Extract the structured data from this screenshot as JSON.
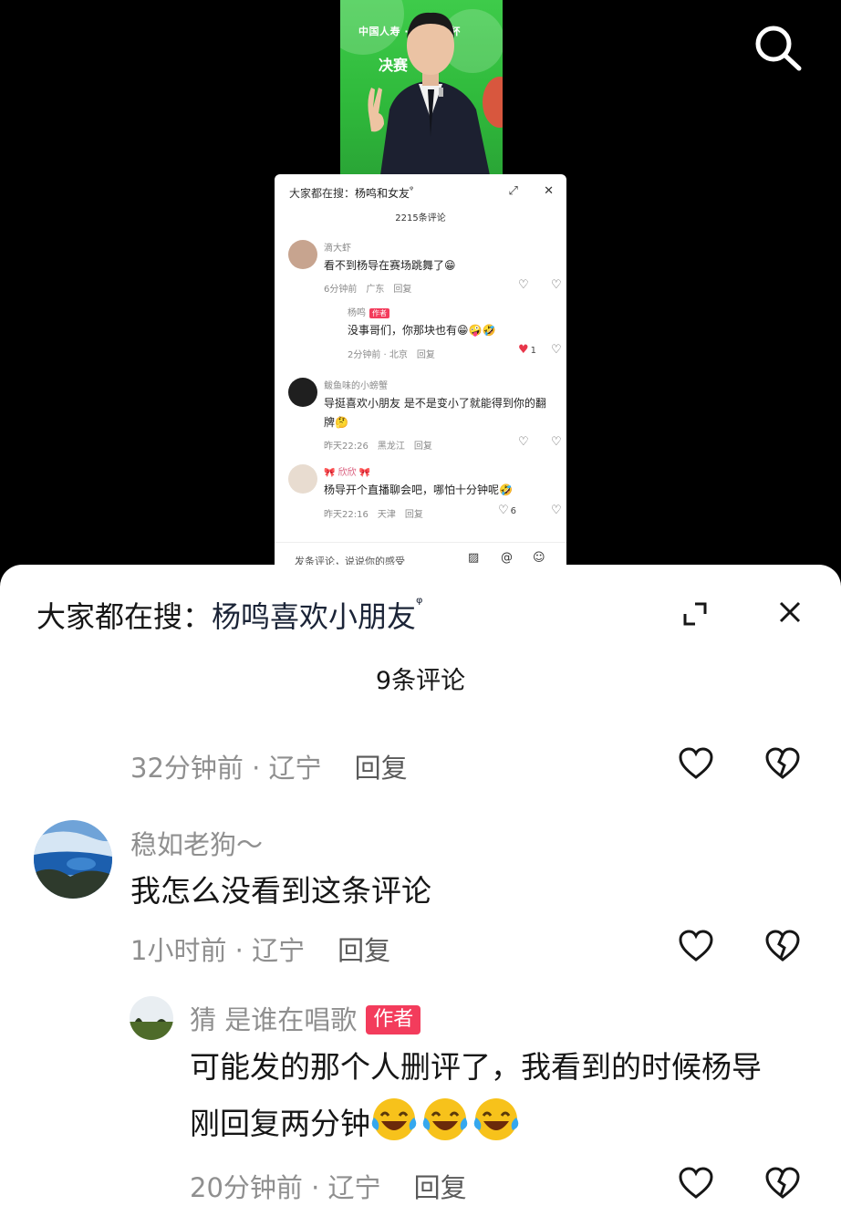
{
  "mini_panel": {
    "search_prefix": "大家都在搜：",
    "search_term": "杨鸣和女友",
    "search_icon_glyph": "ᵠ",
    "expand_glyph": "⤢",
    "close_glyph": "✕",
    "comment_count": "2215条评论",
    "comments": [
      {
        "name": "滴大虾",
        "text": "看不到杨导在赛场跳舞了😁",
        "time": "6分钟前",
        "location": "广东",
        "reply": "回复",
        "likes": ""
      },
      {
        "name": "杨鸣",
        "tag": "作者",
        "text": "没事哥们，你那块也有😁🤪🤣",
        "time": "2分钟前 · 北京",
        "reply": "回复",
        "likes": "1"
      },
      {
        "name": "鲅鱼味的小螃蟹",
        "text": "导挺喜欢小朋友 是不是变小了就能得到你的翻牌🤔",
        "time": "昨天22:26",
        "location": "黑龙江",
        "reply": "回复",
        "likes": ""
      },
      {
        "name": "🎀 欣欣 🎀",
        "text": "杨导开个直播聊会吧，哪怕十分钟呢🤣",
        "time": "昨天22:16",
        "location": "天津",
        "reply": "回复",
        "likes": "6"
      }
    ],
    "input_placeholder": "发条评论，说说你的感受",
    "icons": [
      "image-icon",
      "at-icon",
      "emoji-icon"
    ]
  },
  "sheet": {
    "search_prefix": "大家都在搜：",
    "search_term": "杨鸣喜欢小朋友",
    "search_icon_glyph": "ᵠ",
    "comment_count": "9条评论",
    "prev_meta": {
      "time": "32分钟前 · 辽宁",
      "reply": "回复"
    },
    "comment": {
      "name": "稳如老狗～",
      "text": "我怎么没看到这条评论",
      "time": "1小时前 · 辽宁",
      "reply": "回复"
    },
    "reply_comment": {
      "name": "猜 是谁在唱歌",
      "tag": "作者",
      "line1": "可能发的那个人删评了，我看到的时候杨导",
      "line2": "刚回复两分钟",
      "time": "20分钟前 · 辽宁",
      "reply": "回复"
    }
  },
  "video": {
    "banner_line1": "中国人寿 · · · 乐部杯",
    "banner_line2": "决赛",
    "accent_green": "#3ecb4a"
  },
  "colors": {
    "tag_red": "#f33c5c",
    "meta_gray": "#8f8f8f",
    "heart_red": "#e8364a"
  }
}
